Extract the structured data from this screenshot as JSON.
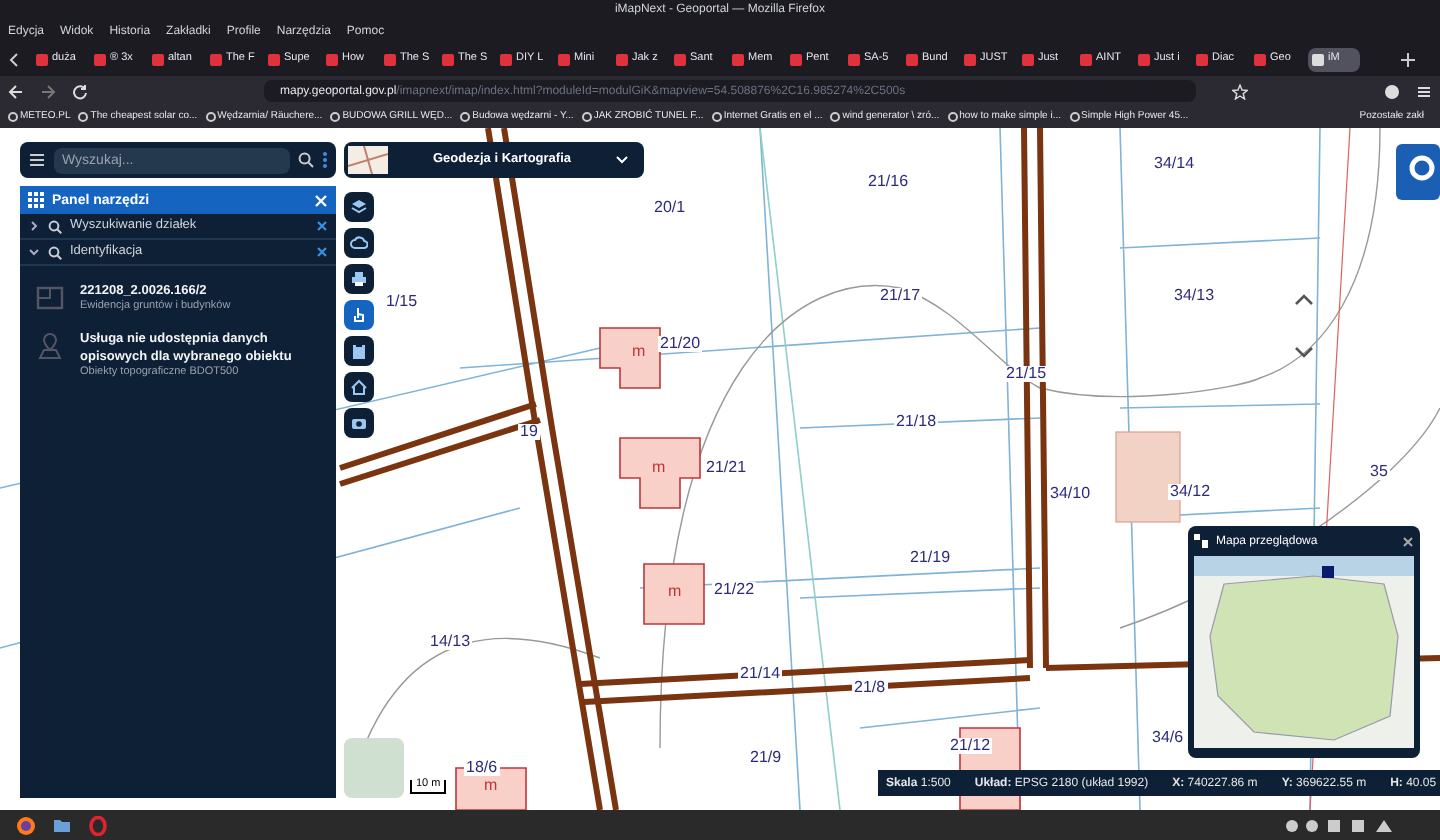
{
  "window": {
    "title": "iMapNext - Geoportal — Mozilla Firefox"
  },
  "menu": [
    "Edycja",
    "Widok",
    "Historia",
    "Zakładki",
    "Profile",
    "Narzędzia",
    "Pomoc"
  ],
  "tabs": [
    {
      "label": "duża",
      "selected": false
    },
    {
      "label": "® 3x",
      "selected": false
    },
    {
      "label": "altan",
      "selected": false
    },
    {
      "label": "The F",
      "selected": false
    },
    {
      "label": "Supe",
      "selected": false
    },
    {
      "label": "How",
      "selected": false
    },
    {
      "label": "The S",
      "selected": false
    },
    {
      "label": "The S",
      "selected": false
    },
    {
      "label": "DIY L",
      "selected": false
    },
    {
      "label": "Mini",
      "selected": false
    },
    {
      "label": "Jak z",
      "selected": false
    },
    {
      "label": "Sant",
      "selected": false
    },
    {
      "label": "Mem",
      "selected": false
    },
    {
      "label": "Pent",
      "selected": false
    },
    {
      "label": "SA-5",
      "selected": false
    },
    {
      "label": "Bund",
      "selected": false
    },
    {
      "label": "JUST",
      "selected": false
    },
    {
      "label": "Just",
      "selected": false
    },
    {
      "label": "AINT",
      "selected": false
    },
    {
      "label": "Just i",
      "selected": false
    },
    {
      "label": "Diac",
      "selected": false
    },
    {
      "label": "Geo",
      "selected": false
    },
    {
      "label": "iM",
      "selected": true
    }
  ],
  "address_bar": {
    "host": "mapy.geoportal.gov.pl",
    "path": "/imapnext/imap/index.html?moduleId=modulGiK&mapview=54.508876%2C16.985274%2C500s"
  },
  "bookmarks": [
    "METEO.PL",
    "The cheapest solar co...",
    "Wędzarnia/ Räuchere...",
    "BUDOWA GRILL WĘD...",
    "Budowa wędzarni - Y...",
    "JAK ZROBIĆ TUNEL F...",
    "Internet Gratis en el ...",
    "wind generator \\ zró...",
    "how to make simple i...",
    "Simple High Power 45..."
  ],
  "bookmarks_more": "Pozostałe zakł",
  "search": {
    "placeholder": "Wyszukaj..."
  },
  "tools_panel": {
    "title": "Panel narzędzi",
    "sections": [
      {
        "label": "Wyszukiwanie działek",
        "expanded": false
      },
      {
        "label": "Identyfikacja",
        "expanded": true
      }
    ],
    "results": [
      {
        "kind": "parcel",
        "title": "221208_2.0026.166/2",
        "subtitle": "Ewidencja gruntów i budynków"
      },
      {
        "kind": "point",
        "title": "Usługa nie udostępnia danych opisowych dla wybranego obiektu",
        "subtitle": "Obiekty topograficzne BDOT500"
      }
    ]
  },
  "map_theme": {
    "label": "Geodezja i Kartografia"
  },
  "map_tools": [
    {
      "kind": "layers",
      "selected": false
    },
    {
      "kind": "cloud",
      "selected": false
    },
    {
      "kind": "print",
      "selected": false
    },
    {
      "kind": "pointer",
      "selected": true
    },
    {
      "kind": "clipboard",
      "selected": false
    },
    {
      "kind": "home",
      "selected": false
    },
    {
      "kind": "camera",
      "selected": false
    }
  ],
  "parcels": [
    "20/1",
    "21/16",
    "34/14",
    "21/17",
    "34/13",
    "21/20",
    "21/15",
    "21/18",
    "21/21",
    "34/10",
    "34/12",
    "35",
    "21/19",
    "21/22",
    "14/13",
    "21/14",
    "21/8",
    "21/12",
    "34/6",
    "21/9",
    "18/6",
    "19",
    "1/15"
  ],
  "building_labels": [
    "m",
    "m",
    "m",
    "m"
  ],
  "scale_bar": "10 m",
  "overview": {
    "title": "Mapa przeglądowa"
  },
  "status_bar": [
    {
      "label": "Skala",
      "value": "1:500"
    },
    {
      "label": "Układ:",
      "value": "EPSG 2180 (układ 1992)"
    },
    {
      "label": "X:",
      "value": "740227.86 m"
    },
    {
      "label": "Y:",
      "value": "369622.55 m"
    },
    {
      "label": "H:",
      "value": "40.05"
    }
  ]
}
